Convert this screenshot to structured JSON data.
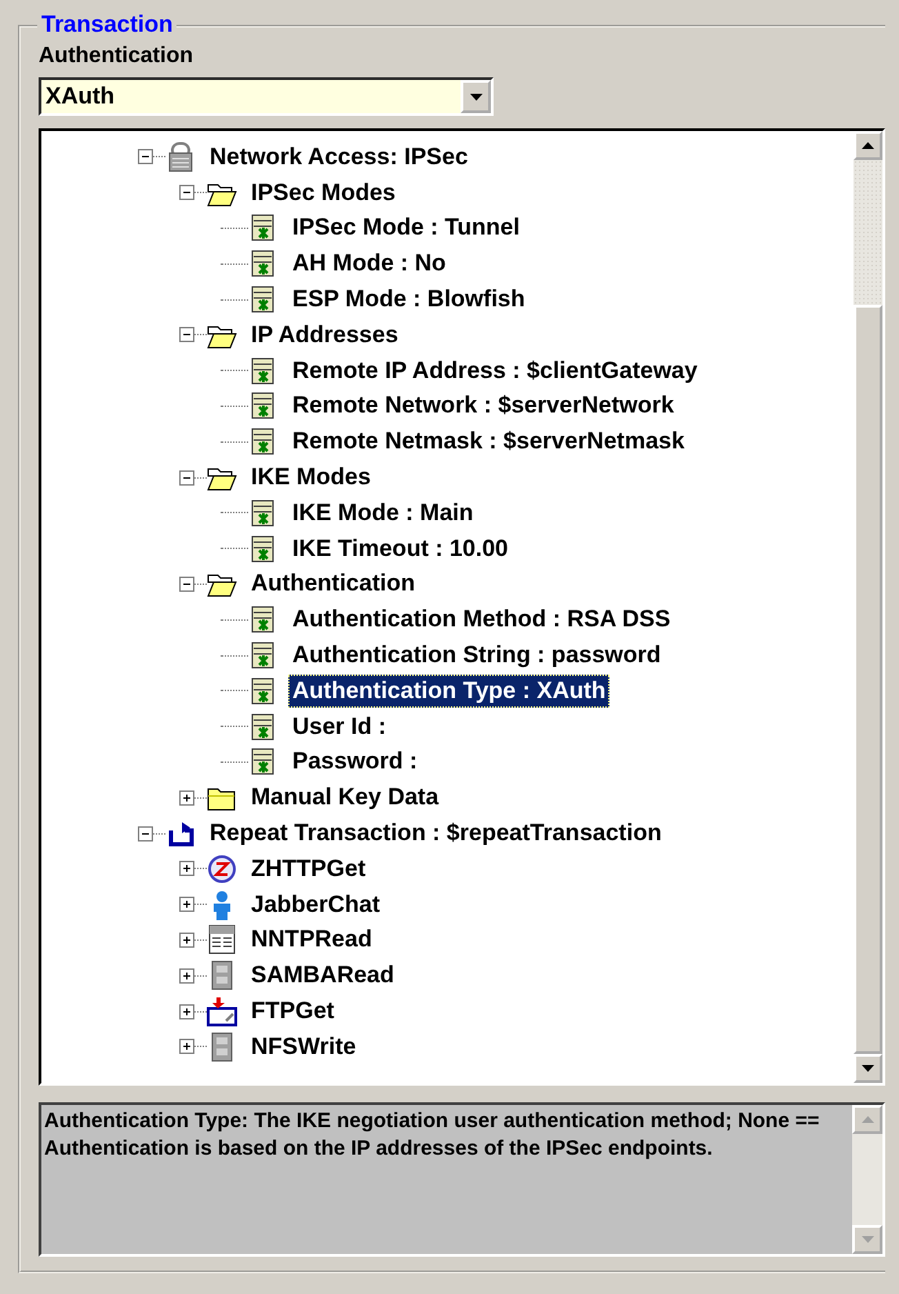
{
  "group": {
    "title": "Transaction"
  },
  "field": {
    "label": "Authentication",
    "value": "XAuth"
  },
  "tree": [
    {
      "label": "Network Access: IPSec",
      "kind": "lock",
      "expanded": true,
      "selected": false,
      "children": [
        {
          "label": "IPSec Modes",
          "kind": "folder",
          "expanded": true,
          "selected": false,
          "children": [
            {
              "label": "IPSec Mode : Tunnel",
              "kind": "setting",
              "selected": false
            },
            {
              "label": "AH Mode : No",
              "kind": "setting",
              "selected": false
            },
            {
              "label": "ESP Mode : Blowfish",
              "kind": "setting",
              "selected": false
            }
          ]
        },
        {
          "label": "IP Addresses",
          "kind": "folder",
          "expanded": true,
          "selected": false,
          "children": [
            {
              "label": "Remote IP Address : $clientGateway",
              "kind": "setting",
              "selected": false
            },
            {
              "label": "Remote Network : $serverNetwork",
              "kind": "setting",
              "selected": false
            },
            {
              "label": "Remote Netmask : $serverNetmask",
              "kind": "setting",
              "selected": false
            }
          ]
        },
        {
          "label": "IKE Modes",
          "kind": "folder",
          "expanded": true,
          "selected": false,
          "children": [
            {
              "label": "IKE Mode : Main",
              "kind": "setting",
              "selected": false
            },
            {
              "label": "IKE Timeout : 10.00",
              "kind": "setting",
              "selected": false
            }
          ]
        },
        {
          "label": "Authentication",
          "kind": "folder",
          "expanded": true,
          "selected": false,
          "children": [
            {
              "label": "Authentication Method : RSA DSS",
              "kind": "setting",
              "selected": false
            },
            {
              "label": "Authentication String : password",
              "kind": "setting",
              "selected": false
            },
            {
              "label": "Authentication Type : XAuth",
              "kind": "setting",
              "selected": true
            },
            {
              "label": "User Id :",
              "kind": "setting",
              "selected": false
            },
            {
              "label": "Password :",
              "kind": "setting",
              "selected": false
            }
          ]
        },
        {
          "label": "Manual Key Data",
          "kind": "folder",
          "expanded": false,
          "selected": false
        }
      ]
    },
    {
      "label": "Repeat Transaction : $repeatTransaction",
      "kind": "repeat",
      "expanded": true,
      "selected": false,
      "children": [
        {
          "label": "ZHTTPGet",
          "kind": "globe",
          "expanded": false,
          "selected": false
        },
        {
          "label": "JabberChat",
          "kind": "person",
          "expanded": false,
          "selected": false
        },
        {
          "label": "NNTPRead",
          "kind": "news",
          "expanded": false,
          "selected": false
        },
        {
          "label": "SAMBARead",
          "kind": "cabinet",
          "expanded": false,
          "selected": false
        },
        {
          "label": "FTPGet",
          "kind": "upload",
          "expanded": false,
          "selected": false
        },
        {
          "label": "NFSWrite",
          "kind": "cabinet",
          "expanded": false,
          "selected": false
        }
      ]
    }
  ],
  "description": "Authentication Type: The IKE negotiation user authentication method; None == Authentication is based on the IP addresses of the IPSec endpoints."
}
